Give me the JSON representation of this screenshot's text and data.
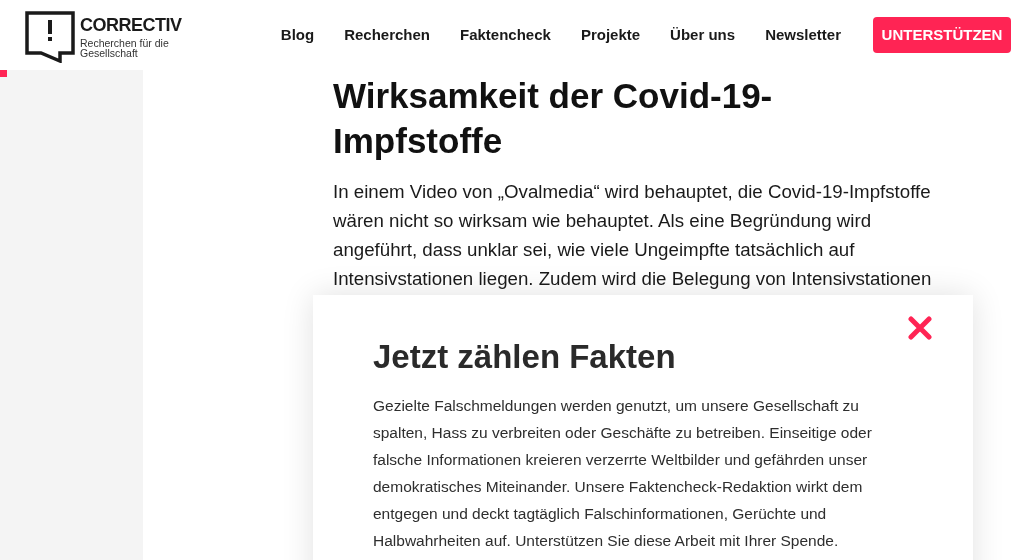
{
  "header": {
    "logo": {
      "name": "CORRECTIV",
      "tagline": "Recherchen für die Gesellschaft"
    },
    "nav": [
      "Blog",
      "Recherchen",
      "Faktencheck",
      "Projekte",
      "Über uns",
      "Newsletter"
    ],
    "donate_button": "UNTERSTÜTZEN"
  },
  "article": {
    "title": "Wirksamkeit der Covid-19-Impfstoffe",
    "lead": "In einem Video von „Ovalmedia“ wird behauptet, die Covid-19-Impfstoffe wären nicht so wirksam wie behauptet. Als eine Begründung wird angeführt, dass unklar sei, wie viele Ungeimpfte tatsächlich auf Intensivstationen liegen. Zudem wird die Belegung von Intensivstationen"
  },
  "donation_dialog": {
    "title": "Jetzt zählen Fakten",
    "text": "Gezielte Falschmeldungen werden genutzt, um unsere Gesellschaft zu spalten, Hass zu verbreiten oder Geschäfte zu betreiben. Einseitige oder falsche Informationen kreieren verzerrte Weltbilder und gefährden unser demokratisches Miteinander. Unsere Faktencheck-Redaktion wirkt dem entgegen und deckt tagtäglich Falschinformationen, Gerüchte und Halbwahrheiten auf. Unterstützen Sie diese Arbeit mit Ihrer Spende."
  }
}
